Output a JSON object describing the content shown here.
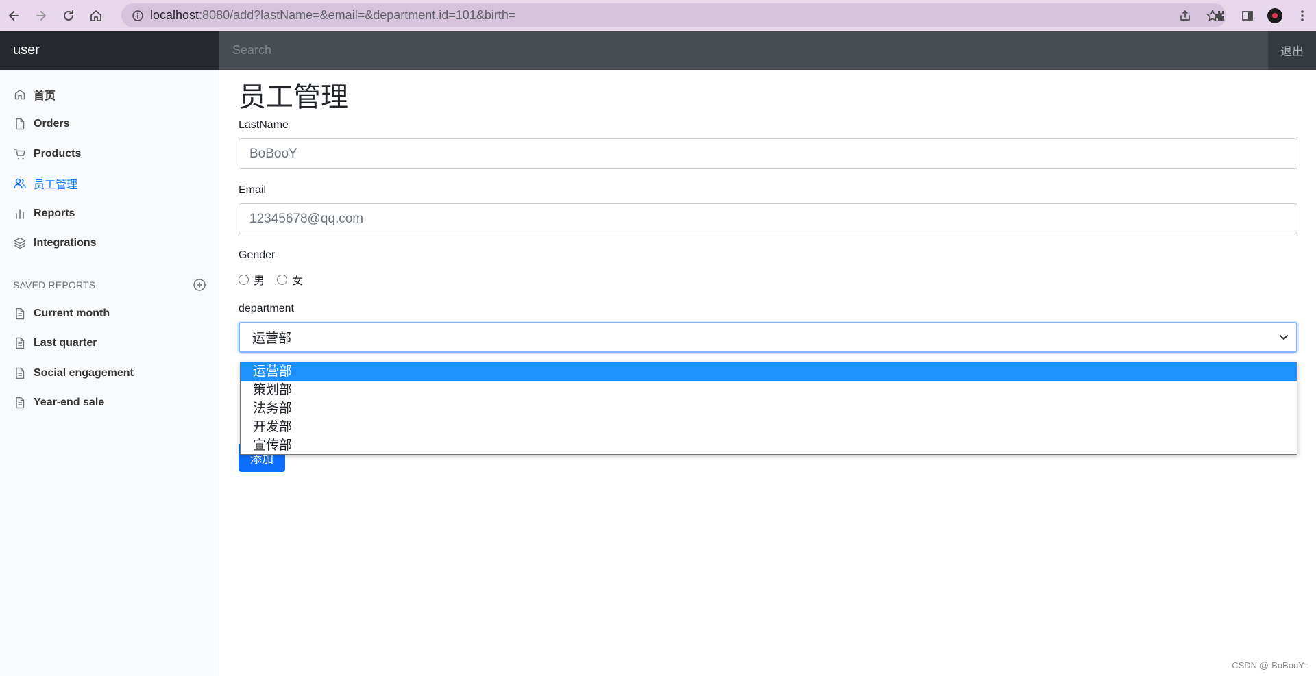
{
  "browser": {
    "url_host": "localhost",
    "url_rest": ":8080/add?lastName=&email=&department.id=101&birth=",
    "icons": [
      "back-icon",
      "forward-icon",
      "reload-icon",
      "home-icon",
      "site-info-icon",
      "share-icon",
      "bookmark-star-icon",
      "extensions-icon",
      "side-panel-icon",
      "profile-avatar",
      "menu-kebab-icon"
    ]
  },
  "navbar": {
    "brand": "user",
    "search_placeholder": "Search",
    "logout_label": "退出"
  },
  "sidebar": {
    "items": [
      {
        "label": "首页",
        "icon": "home-icon",
        "active": false
      },
      {
        "label": "Orders",
        "icon": "file-icon",
        "active": false
      },
      {
        "label": "Products",
        "icon": "cart-icon",
        "active": false
      },
      {
        "label": "员工管理",
        "icon": "users-icon",
        "active": true
      },
      {
        "label": "Reports",
        "icon": "bar-chart-icon",
        "active": false
      },
      {
        "label": "Integrations",
        "icon": "layers-icon",
        "active": false
      }
    ],
    "saved_reports_heading": "SAVED REPORTS",
    "saved_reports": [
      {
        "label": "Current month",
        "icon": "file-text-icon"
      },
      {
        "label": "Last quarter",
        "icon": "file-text-icon"
      },
      {
        "label": "Social engagement",
        "icon": "file-text-icon"
      },
      {
        "label": "Year-end sale",
        "icon": "file-text-icon"
      }
    ]
  },
  "main": {
    "title": "员工管理",
    "lastname_label": "LastName",
    "lastname_value": "BoBooY",
    "email_label": "Email",
    "email_value": "12345678@qq.com",
    "gender_label": "Gender",
    "gender_options": [
      "男",
      "女"
    ],
    "department_label": "department",
    "department_selected": "运营部",
    "department_options": [
      "运营部",
      "策划部",
      "法务部",
      "开发部",
      "宣传部"
    ],
    "submit_label": "添加"
  },
  "accent_color": "#0d7bff",
  "watermark": "CSDN @-BoBooY-"
}
